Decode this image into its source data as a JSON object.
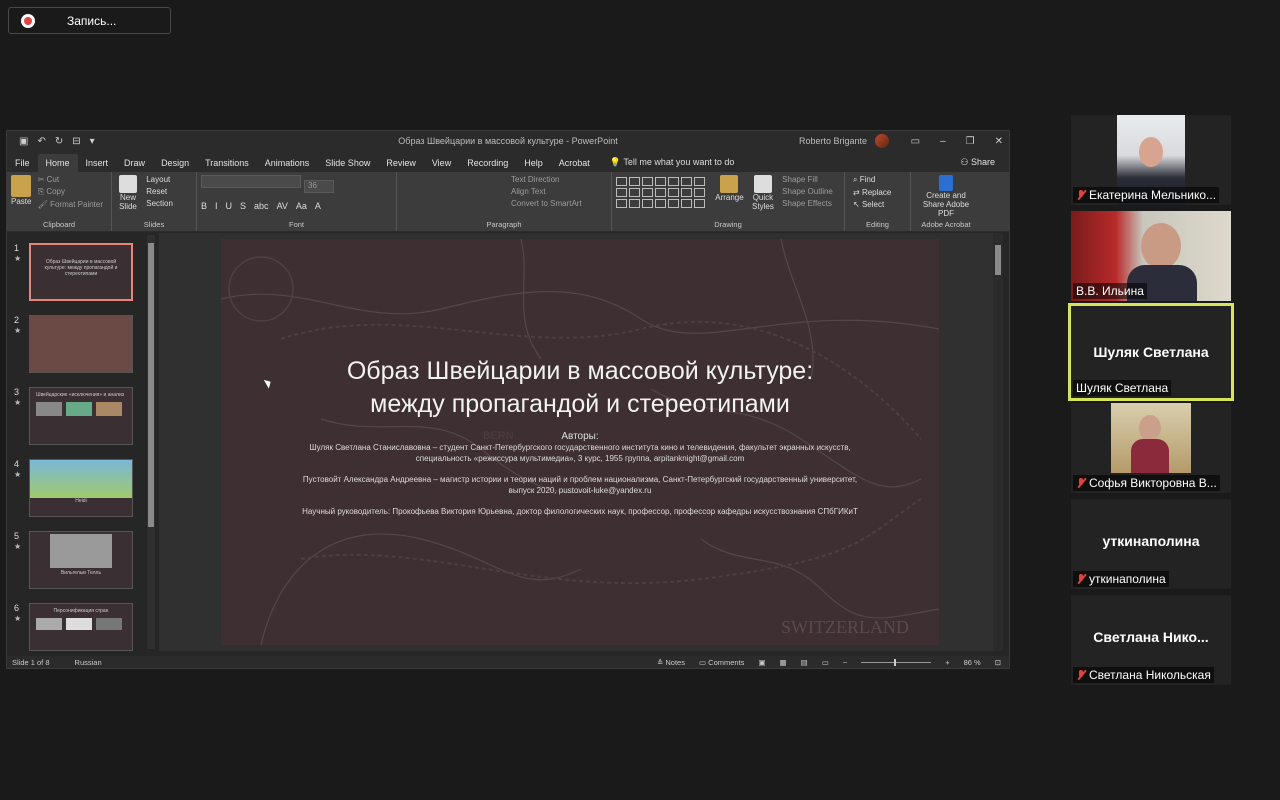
{
  "recording": {
    "label": "Запись..."
  },
  "ppt": {
    "title": "Образ Швейцарии в массовой культуре  -  PowerPoint",
    "user": "Roberto Brigante",
    "tabs": [
      "File",
      "Home",
      "Insert",
      "Draw",
      "Design",
      "Transitions",
      "Animations",
      "Slide Show",
      "Review",
      "View",
      "Recording",
      "Help",
      "Acrobat"
    ],
    "tell_me": "Tell me what you want to do",
    "share": "Share",
    "ribbon": {
      "clipboard": {
        "paste": "Paste",
        "cut": "Cut",
        "copy": "Copy",
        "painter": "Format Painter",
        "label": "Clipboard"
      },
      "slides": {
        "new": "New Slide",
        "layout": "Layout",
        "reset": "Reset",
        "section": "Section",
        "label": "Slides"
      },
      "font": {
        "size": "36",
        "label": "Font",
        "buttons": [
          "B",
          "I",
          "U",
          "S",
          "abc",
          "AV",
          "Aa",
          "A"
        ]
      },
      "paragraph": {
        "dir": "Text Direction",
        "align": "Align Text",
        "smart": "Convert to SmartArt",
        "label": "Paragraph"
      },
      "drawing": {
        "arrange": "Arrange",
        "quick": "Quick Styles",
        "fill": "Shape Fill",
        "outline": "Shape Outline",
        "effects": "Shape Effects",
        "label": "Drawing"
      },
      "editing": {
        "find": "Find",
        "replace": "Replace",
        "select": "Select",
        "label": "Editing"
      },
      "acrobat": {
        "create": "Create and Share Adobe PDF",
        "label": "Adobe Acrobat"
      }
    },
    "thumbnails": [
      {
        "num": "1",
        "caption": "Образ Швейцарии в массовой культуре: между пропагандой и стереотипами"
      },
      {
        "num": "2",
        "caption": ""
      },
      {
        "num": "3",
        "caption": "Швейцарские «исключения» и анализ"
      },
      {
        "num": "4",
        "caption": "Heidi"
      },
      {
        "num": "5",
        "caption": "Вильгельм Телль"
      },
      {
        "num": "6",
        "caption": "Персонификация стран"
      }
    ],
    "slide": {
      "title_line1": "Образ Швейцарии в массовой культуре:",
      "title_line2": "между пропагандой и стереотипами",
      "authors_head": "Авторы:",
      "author1": "Шуляк Светлана Станиславовна – студент Санкт-Петербургского государственного института кино и телевидения, факультет экранных искусств, специальность «режиссура мультимедиа», 3 курс, 1955 группа, arpitanknight@gmail.com",
      "author2": "Пустовойт Александра Андреевна – магистр истории и теории наций и проблем национализма, Санкт-Петербургский государственный университет, выпуск 2020, pustovoit-luke@yandex.ru",
      "advisor": "Научный руководитель: Прокофьева Виктория Юрьевна, доктор филологических наук, профессор, профессор кафедры искусствознания СПбГИКиТ",
      "map_text": "SWITZERLAND",
      "bern": "BERN"
    },
    "status": {
      "slide": "Slide 1 of 8",
      "lang": "Russian",
      "notes": "Notes",
      "comments": "Comments",
      "zoom": "86 %"
    }
  },
  "participants": [
    {
      "name": "Екатерина Мельнико...",
      "muted": true,
      "video": true
    },
    {
      "name": "В.В. Ильина",
      "muted": false,
      "video": true
    },
    {
      "name": "Шуляк Светлана",
      "muted": false,
      "video": false,
      "big": "Шуляк Светлана",
      "speaking": true
    },
    {
      "name": "Софья Викторовна В...",
      "muted": true,
      "video": true
    },
    {
      "name": "уткинаполина",
      "muted": true,
      "video": false,
      "big": "уткинаполина"
    },
    {
      "name": "Светлана Никольская",
      "muted": true,
      "video": false,
      "big": "Светлана  Нико..."
    }
  ]
}
